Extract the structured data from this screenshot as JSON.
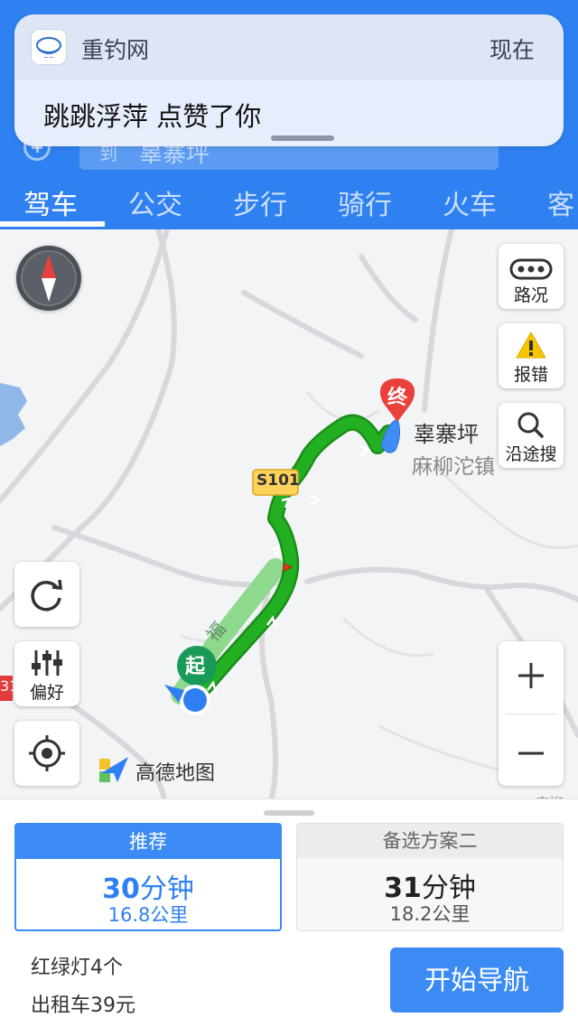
{
  "notification": {
    "app_name": "重钓网",
    "time": "现在",
    "message": "跳跳浮萍 点赞了你"
  },
  "header": {
    "destination_label": "到",
    "destination_value": "辜寨坪",
    "tabs": [
      {
        "label": "驾车",
        "active": true
      },
      {
        "label": "公交",
        "active": false
      },
      {
        "label": "步行",
        "active": false
      },
      {
        "label": "骑行",
        "active": false
      },
      {
        "label": "火车",
        "active": false
      },
      {
        "label": "客",
        "active": false
      }
    ]
  },
  "map": {
    "road_badge": "S101",
    "road_badge_left": "31",
    "start_marker": "起",
    "end_marker": "终",
    "destination_name": "辜寨坪",
    "town_name": "麻柳沱镇",
    "road_name": "福",
    "corner_label": "麻柳",
    "logo_text": "高德地图",
    "controls": {
      "traffic": "路况",
      "report": "报错",
      "search_along": "沿途搜",
      "preference": "偏好"
    },
    "colors": {
      "route": "#22a822",
      "water": "#3f8cf3",
      "brand": "#2f80f0"
    }
  },
  "routes": {
    "recommended": {
      "tag": "推荐",
      "time_number": "30",
      "time_unit": "分钟",
      "distance": "16.8公里"
    },
    "alternative": {
      "tag": "备选方案二",
      "time_number": "31",
      "time_unit": "分钟",
      "distance": "18.2公里"
    }
  },
  "summary": {
    "traffic_lights": "红绿灯4个",
    "taxi_fare": "出租车39元",
    "start_button": "开始导航"
  }
}
